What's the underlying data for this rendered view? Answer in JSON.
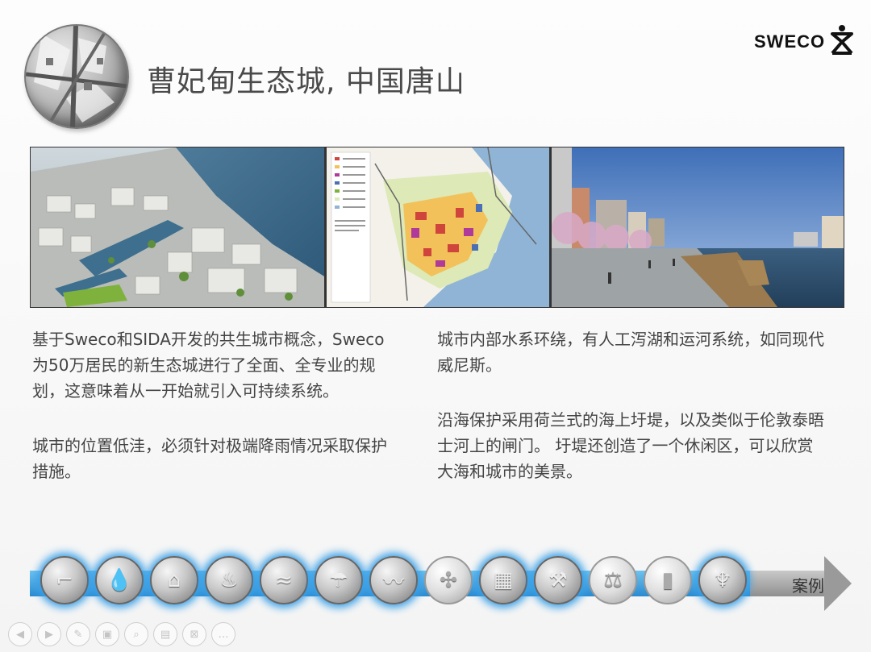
{
  "slide": {
    "title": "曹妃甸生态城, 中国唐山",
    "brand": "SWECO",
    "left_paragraphs": [
      "基于Sweco和SIDA开发的共生城市概念，Sweco为50万居民的新生态城进行了全面、全专业的规划，这意味着从一开始就引入可持续系统。",
      "城市的位置低洼，必须针对极端降雨情况采取保护措施。"
    ],
    "right_paragraphs": [
      "城市内部水系环绕，有人工泻湖和运河系统，如同现代威尼斯。",
      "沿海保护采用荷兰式的海上圩堤，以及类似于伦敦泰晤士河上的闸门。 圩堤还创造了一个休闲区，可以欣赏大海和城市的美景。"
    ]
  },
  "timeline": {
    "label": "案例",
    "icons": [
      {
        "name": "faucet-icon",
        "glyph": "⌐",
        "active": true
      },
      {
        "name": "water-drop-icon",
        "glyph": "💧",
        "active": true
      },
      {
        "name": "toilet-icon",
        "glyph": "⌂",
        "active": true
      },
      {
        "name": "fire-icon",
        "glyph": "♨",
        "active": true
      },
      {
        "name": "river-icon",
        "glyph": "≈",
        "active": true
      },
      {
        "name": "umbrella-icon",
        "glyph": "☂",
        "active": true
      },
      {
        "name": "waves-icon",
        "glyph": "〰",
        "active": true
      },
      {
        "name": "wind-turbine-icon",
        "glyph": "✣",
        "active": false
      },
      {
        "name": "city-map-icon",
        "glyph": "▦",
        "active": true
      },
      {
        "name": "crane-icon",
        "glyph": "⚒",
        "active": true
      },
      {
        "name": "scales-icon",
        "glyph": "⚖",
        "active": false
      },
      {
        "name": "trash-bin-icon",
        "glyph": "▮",
        "active": false
      },
      {
        "name": "swan-icon",
        "glyph": "♆",
        "active": true
      }
    ]
  },
  "nav": [
    {
      "name": "prev-slide-icon",
      "glyph": "◀"
    },
    {
      "name": "next-slide-icon",
      "glyph": "▶"
    },
    {
      "name": "pen-icon",
      "glyph": "✎"
    },
    {
      "name": "slides-grid-icon",
      "glyph": "▣"
    },
    {
      "name": "zoom-icon",
      "glyph": "⌕"
    },
    {
      "name": "subtitles-icon",
      "glyph": "▤"
    },
    {
      "name": "screen-off-icon",
      "glyph": "⊠"
    },
    {
      "name": "more-icon",
      "glyph": "…"
    }
  ],
  "colors": {
    "accent_blue": "#2a8ad0",
    "title_gray": "#4a4a4a"
  }
}
